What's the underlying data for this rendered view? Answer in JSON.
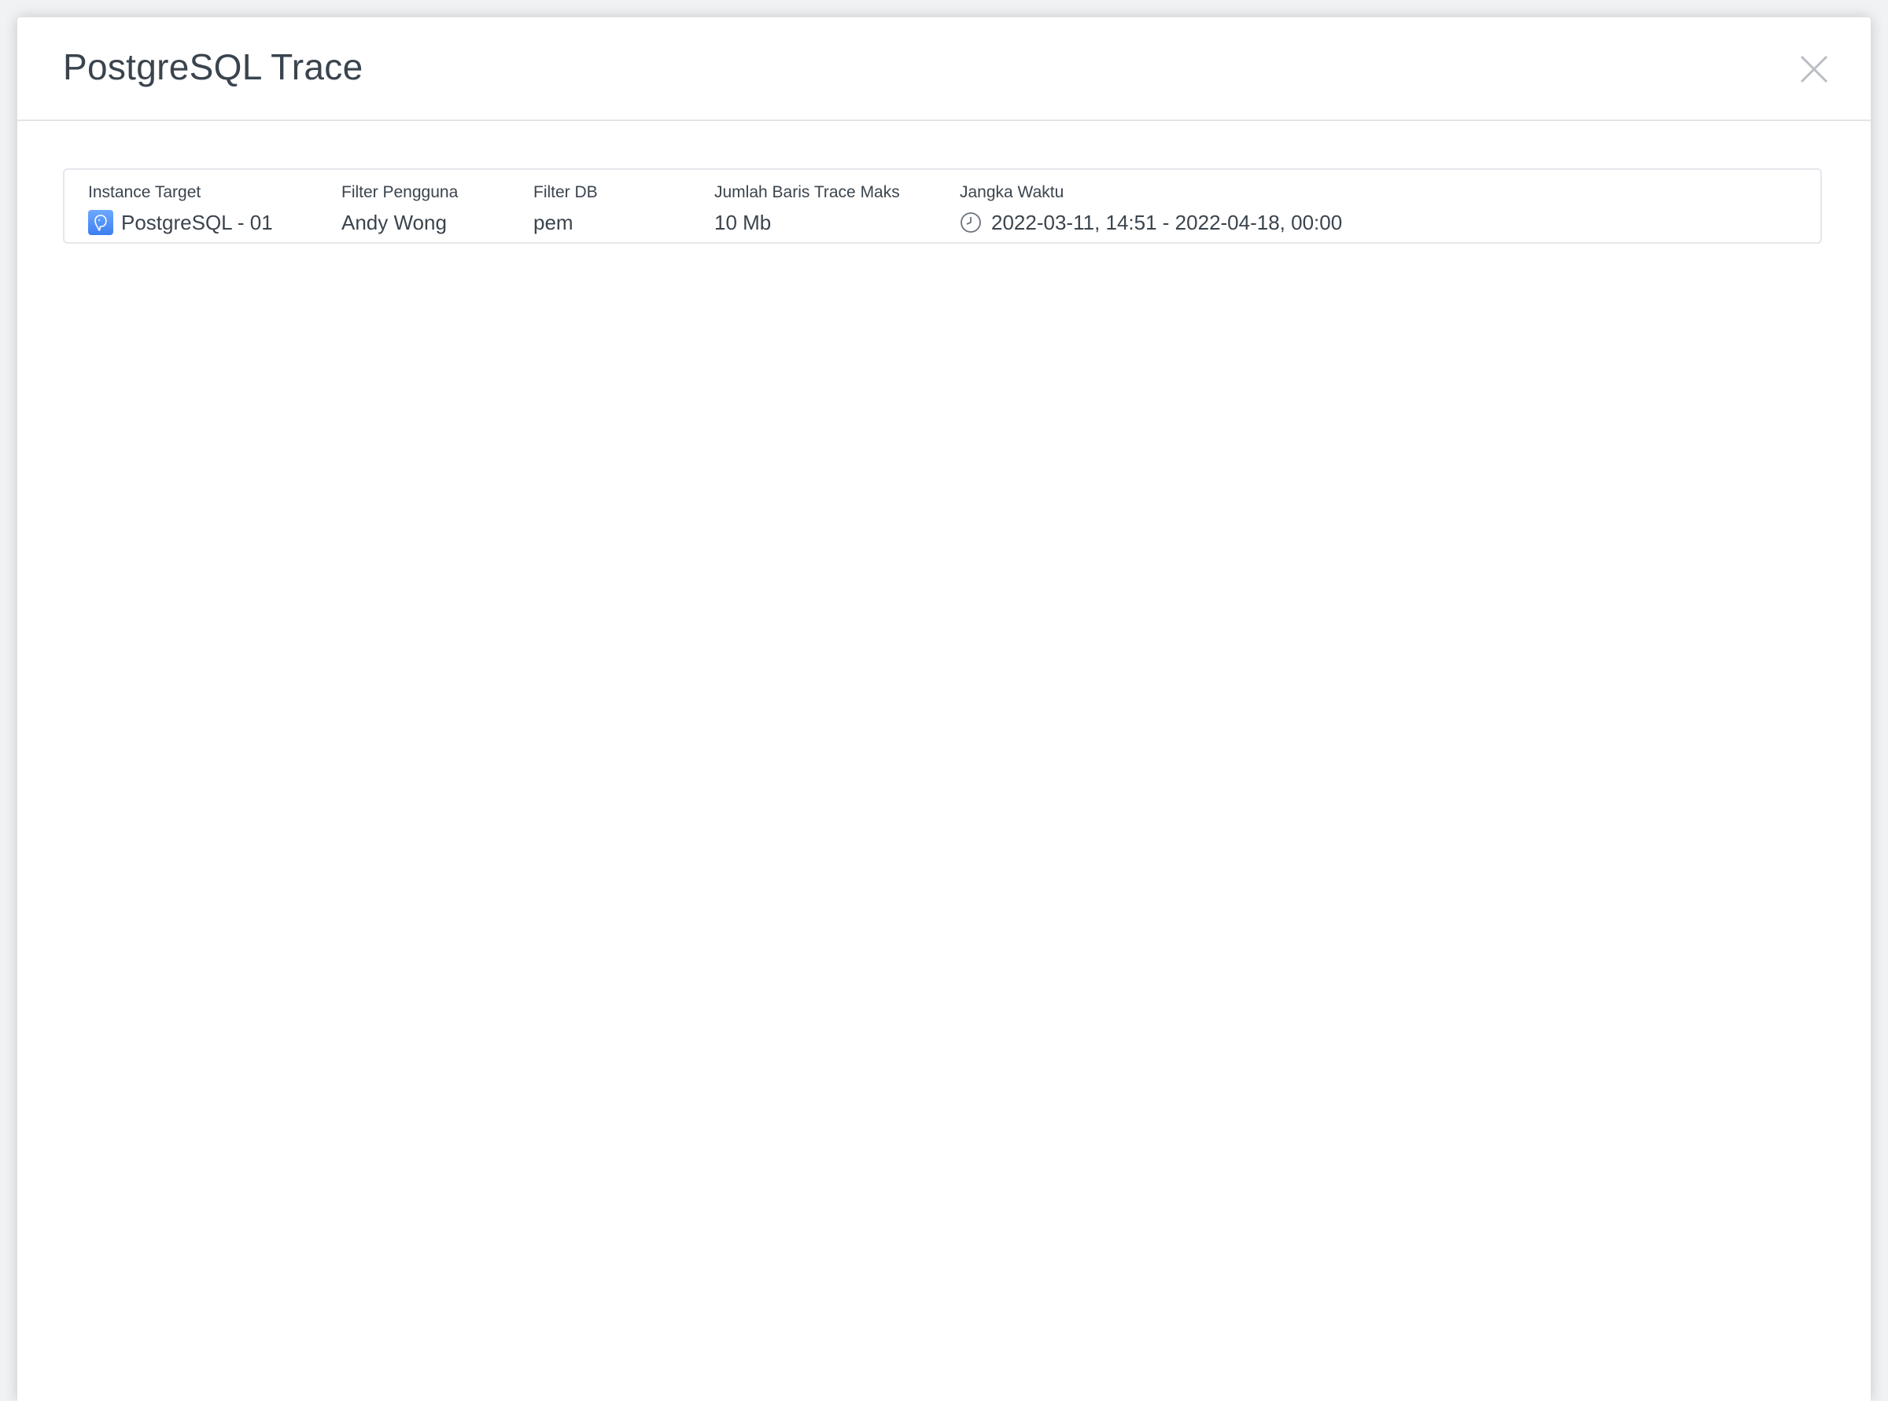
{
  "modal": {
    "title": "PostgreSQL Trace",
    "close_icon": "close-icon"
  },
  "trace_info": {
    "instance_target": {
      "label": "Instance Target",
      "value": "PostgreSQL - 01",
      "icon": "postgresql-icon"
    },
    "user_filter": {
      "label": "Filter Pengguna",
      "value": "Andy Wong"
    },
    "db_filter": {
      "label": "Filter DB",
      "value": "pem"
    },
    "max_trace_rows": {
      "label": "Jumlah Baris Trace Maks",
      "value": "10 Mb"
    },
    "time_range": {
      "label": "Jangka Waktu",
      "value": "2022-03-11, 14:51 - 2022-04-18, 00:00",
      "icon": "clock-icon"
    }
  },
  "colors": {
    "accent": "#3c7ef0",
    "text": "#3b444d",
    "border": "#e4e7eb"
  }
}
